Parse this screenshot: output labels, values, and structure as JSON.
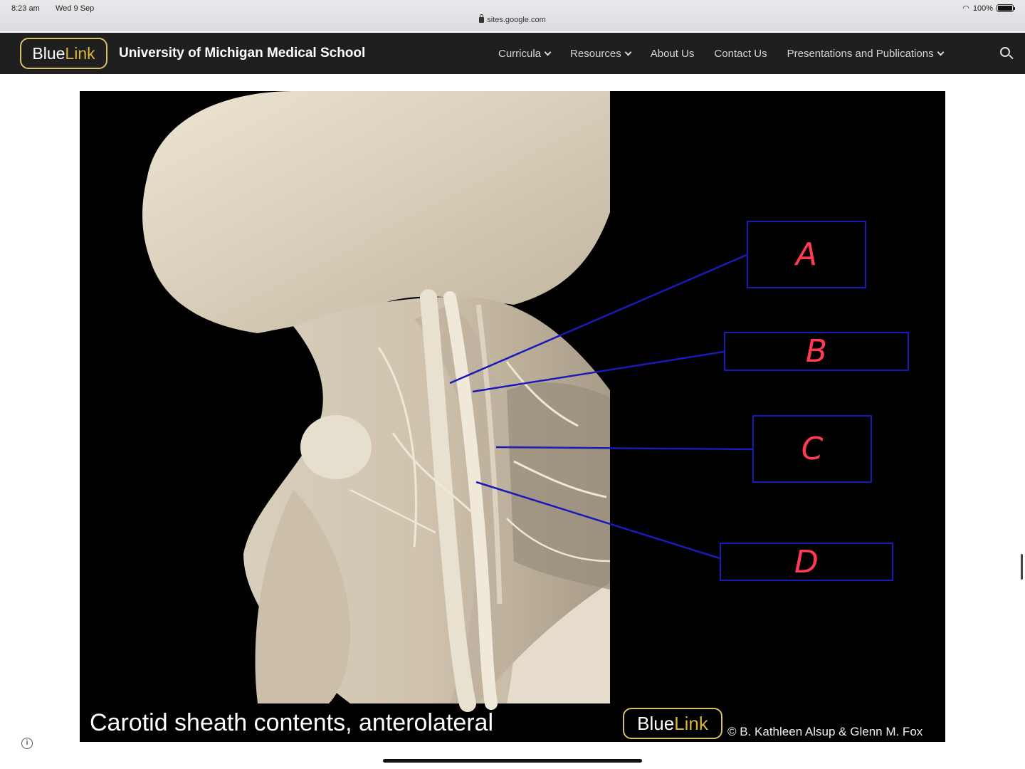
{
  "status_bar": {
    "time": "8:23 am",
    "date": "Wed 9 Sep",
    "url": "sites.google.com",
    "battery": "100%",
    "icons": [
      "lock-icon",
      "wifi-icon",
      "battery-icon"
    ]
  },
  "site_header": {
    "logo_blue": "Blue",
    "logo_link": "Link",
    "title": "University of Michigan Medical School",
    "nav": [
      {
        "label": "Curricula",
        "has_dropdown": true
      },
      {
        "label": "Resources",
        "has_dropdown": true
      },
      {
        "label": "About Us",
        "has_dropdown": false
      },
      {
        "label": "Contact Us",
        "has_dropdown": false
      },
      {
        "label": "Presentations and Publications",
        "has_dropdown": true
      }
    ],
    "colors": {
      "background": "#1f1f1f",
      "accent": "#d8b43a"
    }
  },
  "figure": {
    "caption": "Carotid sheath contents, anterolateral",
    "logo_blue": "Blue",
    "logo_link": "Link",
    "copyright": "© B. Kathleen Alsup & Glenn M. Fox",
    "labels": [
      "A",
      "B",
      "C",
      "D"
    ],
    "colors": {
      "label_text": "#ff3a55",
      "label_border": "#1a1ab8",
      "leader_line": "#1a1ab8"
    }
  }
}
